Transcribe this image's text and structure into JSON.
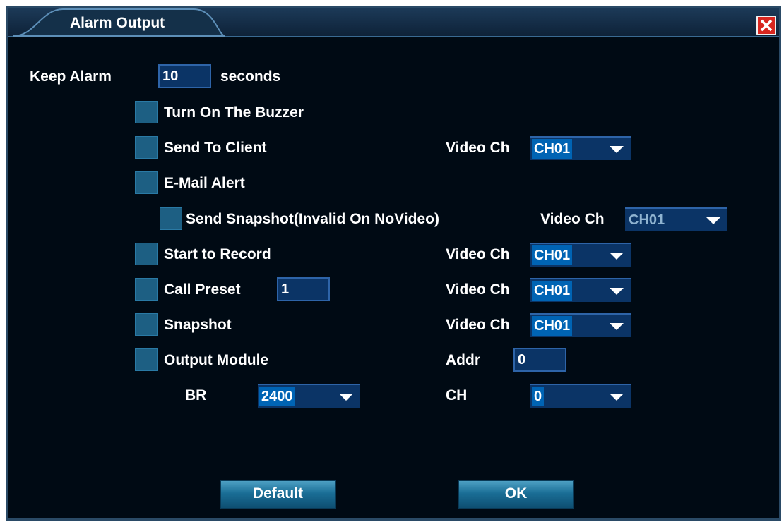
{
  "window": {
    "title": "Alarm Output",
    "close_label": "close"
  },
  "keep_alarm": {
    "label": "Keep Alarm",
    "value": "10",
    "unit": "seconds"
  },
  "options": {
    "buzzer": {
      "label": "Turn On The Buzzer",
      "checked": true
    },
    "send_to_client": {
      "label": "Send To Client",
      "checked": true,
      "channel_label": "Video Ch",
      "channel_value": "CH01"
    },
    "email_alert": {
      "label": "E-Mail Alert",
      "checked": true
    },
    "send_snapshot": {
      "label": "Send Snapshot(Invalid On NoVideo)",
      "checked": true,
      "channel_label": "Video Ch",
      "channel_value": "CH01"
    },
    "start_record": {
      "label": "Start to Record",
      "checked": true,
      "channel_label": "Video Ch",
      "channel_value": "CH01"
    },
    "call_preset": {
      "label": "Call Preset",
      "checked": true,
      "preset_value": "1",
      "channel_label": "Video Ch",
      "channel_value": "CH01"
    },
    "snapshot": {
      "label": "Snapshot",
      "checked": true,
      "channel_label": "Video Ch",
      "channel_value": "CH01"
    },
    "output_module": {
      "label": "Output Module",
      "checked": true,
      "addr_label": "Addr",
      "addr_value": "0"
    }
  },
  "serial": {
    "br_label": "BR",
    "br_value": "2400",
    "ch_label": "CH",
    "ch_value": "0"
  },
  "buttons": {
    "default": "Default",
    "ok": "OK"
  },
  "colors": {
    "background": "#000a14",
    "checkbox": "#1d5f83",
    "field": "#0b3466",
    "highlight": "#0064b4",
    "close": "#d8261f"
  }
}
